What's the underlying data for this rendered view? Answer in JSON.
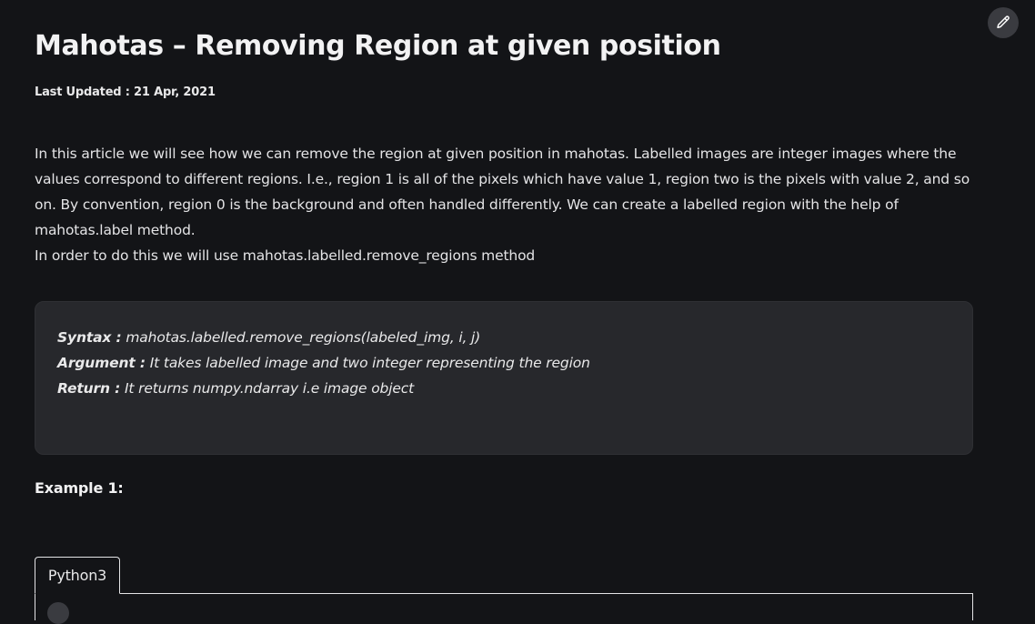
{
  "article": {
    "title": "Mahotas – Removing Region at given position",
    "last_updated": "Last Updated : 21 Apr, 2021",
    "intro": "In this article we will see how we can remove the region at given position in mahotas. Labelled images are integer images where the values correspond to different regions. I.e., region 1 is all of the pixels which have value 1, region two is the pixels with value 2, and so on. By convention, region 0 is the background and often handled differently. We can create a labelled region with the help of mahotas.label method.",
    "method_note": "In order to do this we will use mahotas.labelled.remove_regions method"
  },
  "syntax_box": {
    "syntax_label": "Syntax :",
    "syntax_value": " mahotas.labelled.remove_regions(labeled_img, i, j)",
    "argument_label": "Argument :",
    "argument_value": " It takes labelled image and two integer representing the region",
    "return_label": "Return :",
    "return_value": " It returns numpy.ndarray i.e image object"
  },
  "example": {
    "heading": "Example 1:",
    "language_tab": "Python3"
  },
  "icons": {
    "edit": "pencil-icon"
  },
  "colors": {
    "background": "#131417",
    "syntax_box_bg": "#27282c",
    "text": "#e9e9ea"
  }
}
